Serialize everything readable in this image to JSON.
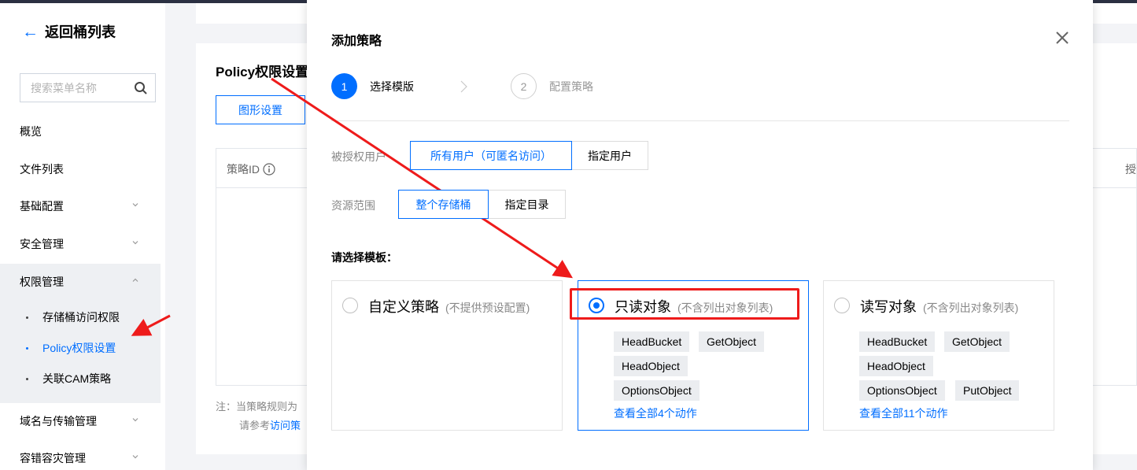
{
  "sidebar": {
    "back_label": "返回桶列表",
    "search_placeholder": "搜索菜单名称",
    "items": [
      {
        "label": "概览"
      },
      {
        "label": "文件列表"
      },
      {
        "label": "基础配置"
      },
      {
        "label": "安全管理"
      },
      {
        "label": "权限管理"
      },
      {
        "label": "域名与传输管理"
      },
      {
        "label": "容错容灾管理"
      }
    ],
    "sub_items": [
      {
        "label": "存储桶访问权限"
      },
      {
        "label": "Policy权限设置"
      },
      {
        "label": "关联CAM策略"
      }
    ]
  },
  "main": {
    "title": "Policy权限设置",
    "graph_button": "图形设置",
    "col_policy_id": "策略ID",
    "col_right_partial": "授",
    "note_line1": "注：当策略规则为",
    "note_line2_prefix": "请参考",
    "note_line2_link": "访问策"
  },
  "modal": {
    "title": "添加策略",
    "steps": [
      {
        "num": "1",
        "label": "选择模版"
      },
      {
        "num": "2",
        "label": "配置策略"
      }
    ],
    "authorized_user_label": "被授权用户",
    "user_options": [
      "所有用户（可匿名访问）",
      "指定用户"
    ],
    "resource_label": "资源范围",
    "resource_options": [
      "整个存储桶",
      "指定目录"
    ],
    "template_label": "请选择模板：",
    "templates": [
      {
        "title": "自定义策略",
        "subtitle": "(不提供预设配置)",
        "actions": [],
        "link": ""
      },
      {
        "title": "只读对象",
        "subtitle": "(不含列出对象列表)",
        "actions": [
          "HeadBucket",
          "GetObject",
          "HeadObject",
          "OptionsObject"
        ],
        "link": "查看全部4个动作"
      },
      {
        "title": "读写对象",
        "subtitle": "(不含列出对象列表)",
        "actions": [
          "HeadBucket",
          "GetObject",
          "HeadObject",
          "OptionsObject",
          "PutObject"
        ],
        "link": "查看全部11个动作"
      }
    ]
  },
  "colors": {
    "accent": "#006eff",
    "annotation": "#ee1b1b",
    "sidebar_active_bg": "#eef0f3"
  }
}
